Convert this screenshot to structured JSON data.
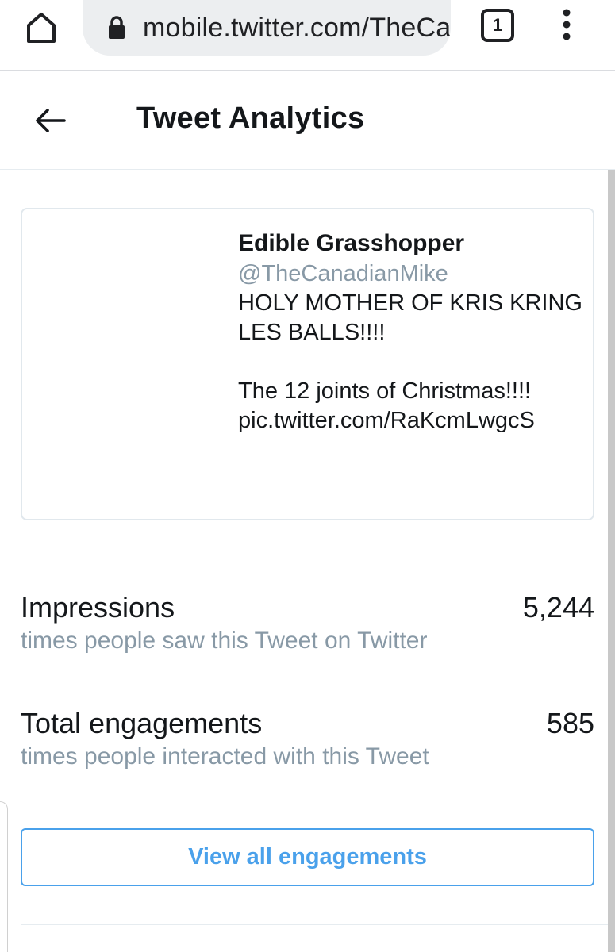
{
  "browser": {
    "url": "mobile.twitter.com/TheCanadianMike/status",
    "tab_count": "1"
  },
  "header": {
    "title": "Tweet Analytics"
  },
  "tweet": {
    "author_name": "Edible Grasshopper",
    "author_handle": "@TheCanadianMike",
    "text": "HOLY MOTHER OF KRIS KRINGLES BALLS!!!!\n\nThe 12 joints of Christmas!!!!\npic.twitter.com/RaKcmLwgcS"
  },
  "metrics": {
    "impressions": {
      "label": "Impressions",
      "description": "times people saw this Tweet on Twitter",
      "value": "5,244"
    },
    "engagements": {
      "label": "Total engagements",
      "description": "times people interacted with this Tweet",
      "value": "585"
    }
  },
  "actions": {
    "view_all_label": "View all engagements"
  },
  "colors": {
    "accent": "#4aa1eb",
    "secondary_text": "#8899a6",
    "primary_text": "#14171a",
    "border": "#e1e8ed"
  },
  "icons": {
    "home": "home-icon",
    "lock": "lock-icon",
    "tabs": "tab-switcher-icon",
    "menu": "more-vert-icon",
    "back": "back-arrow-icon"
  }
}
